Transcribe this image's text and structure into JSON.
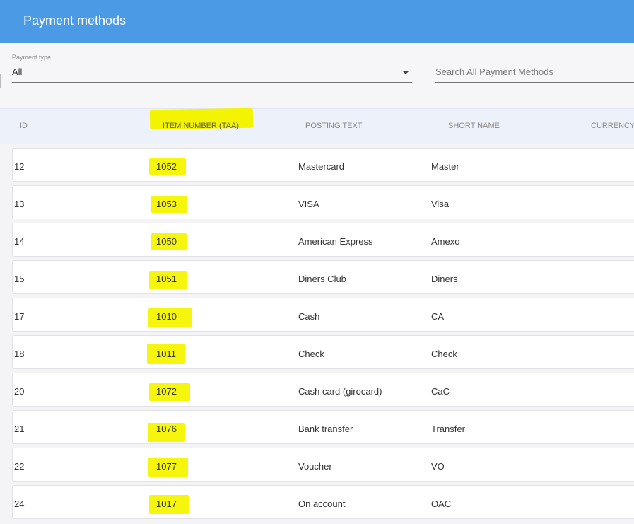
{
  "header": {
    "title": "Payment methods"
  },
  "filters": {
    "payment_type_label": "Payment type",
    "payment_type_value": "All",
    "search_placeholder": "Search All Payment Methods"
  },
  "table": {
    "columns": [
      "ID",
      "ITEM NUMBER (TAA)",
      "POSTING TEXT",
      "SHORT NAME",
      "CURRENCY"
    ],
    "rows": [
      {
        "id": "12",
        "item_number": "1052",
        "posting_text": "Mastercard",
        "short_name": "Master"
      },
      {
        "id": "13",
        "item_number": "1053",
        "posting_text": "VISA",
        "short_name": "Visa"
      },
      {
        "id": "14",
        "item_number": "1050",
        "posting_text": "American Express",
        "short_name": "Amexo"
      },
      {
        "id": "15",
        "item_number": "1051",
        "posting_text": "Diners Club",
        "short_name": "Diners"
      },
      {
        "id": "17",
        "item_number": "1010",
        "posting_text": "Cash",
        "short_name": "CA"
      },
      {
        "id": "18",
        "item_number": "1011",
        "posting_text": "Check",
        "short_name": "Check"
      },
      {
        "id": "20",
        "item_number": "1072",
        "posting_text": "Cash card (girocard)",
        "short_name": "CaC"
      },
      {
        "id": "21",
        "item_number": "1076",
        "posting_text": "Bank transfer",
        "short_name": "Transfer"
      },
      {
        "id": "22",
        "item_number": "1077",
        "posting_text": "Voucher",
        "short_name": "VO"
      },
      {
        "id": "24",
        "item_number": "1017",
        "posting_text": "On account",
        "short_name": "OAC"
      }
    ]
  },
  "colors": {
    "header_bg": "#4a9ae6",
    "highlight": "#f4f400",
    "table_header_bg": "#edf1f9"
  }
}
